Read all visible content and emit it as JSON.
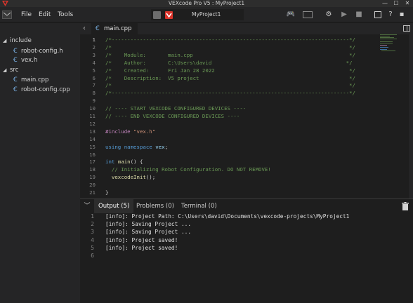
{
  "window": {
    "title": "VEXcode Pro V5 : MyProject1",
    "minimize": "—",
    "maximize": "☐",
    "close": "✕",
    "logo_color": "#d9342b"
  },
  "menu": {
    "items": [
      "File",
      "Edit",
      "Tools"
    ],
    "project_name": "MyProject1"
  },
  "sidebar": {
    "tree": [
      {
        "label": "include",
        "type": "folder",
        "expanded": true,
        "depth": 0
      },
      {
        "label": "robot-config.h",
        "type": "file",
        "depth": 1
      },
      {
        "label": "vex.h",
        "type": "file",
        "depth": 1
      },
      {
        "label": "src",
        "type": "folder",
        "expanded": true,
        "depth": 0
      },
      {
        "label": "main.cpp",
        "type": "file",
        "depth": 1
      },
      {
        "label": "robot-config.cpp",
        "type": "file",
        "depth": 1
      }
    ]
  },
  "editor": {
    "back_label": "‹",
    "active_tab": "main.cpp",
    "active_line": 1,
    "lines": [
      {
        "n": "1",
        "seg": [
          [
            "c-comment",
            "/*----------------------------------------------------------------------------*/"
          ]
        ]
      },
      {
        "n": "2",
        "seg": [
          [
            "c-comment",
            "/*                                                                            */"
          ]
        ]
      },
      {
        "n": "3",
        "seg": [
          [
            "c-comment",
            "/*    Module:       main.cpp                                                  */"
          ]
        ]
      },
      {
        "n": "4",
        "seg": [
          [
            "c-comment",
            "/*    Author:       C:\\Users\\david                                           */"
          ]
        ]
      },
      {
        "n": "5",
        "seg": [
          [
            "c-comment",
            "/*    Created:      Fri Jan 28 2022                                           */"
          ]
        ]
      },
      {
        "n": "6",
        "seg": [
          [
            "c-comment",
            "/*    Description:  V5 project                                                */"
          ]
        ]
      },
      {
        "n": "7",
        "seg": [
          [
            "c-comment",
            "/*                                                                            */"
          ]
        ]
      },
      {
        "n": "8",
        "seg": [
          [
            "c-comment",
            "/*----------------------------------------------------------------------------*/"
          ]
        ]
      },
      {
        "n": "9",
        "seg": []
      },
      {
        "n": "10",
        "seg": [
          [
            "c-comment",
            "// ---- START VEXCODE CONFIGURED DEVICES ----"
          ]
        ]
      },
      {
        "n": "11",
        "seg": [
          [
            "c-comment",
            "// ---- END VEXCODE CONFIGURED DEVICES ----"
          ]
        ]
      },
      {
        "n": "12",
        "seg": []
      },
      {
        "n": "13",
        "seg": [
          [
            "c-pre",
            "#include "
          ],
          [
            "c-str",
            "\"vex.h\""
          ]
        ]
      },
      {
        "n": "14",
        "seg": []
      },
      {
        "n": "15",
        "seg": [
          [
            "c-kw",
            "using namespace "
          ],
          [
            "c-var",
            "vex"
          ],
          [
            "c-plain",
            ";"
          ]
        ]
      },
      {
        "n": "16",
        "seg": []
      },
      {
        "n": "17",
        "seg": [
          [
            "c-kw",
            "int "
          ],
          [
            "c-fn",
            "main"
          ],
          [
            "c-plain",
            "() {"
          ]
        ]
      },
      {
        "n": "18",
        "seg": [
          [
            "c-comment",
            "  // Initializing Robot Configuration. DO NOT REMOVE!"
          ]
        ]
      },
      {
        "n": "19",
        "seg": [
          [
            "c-fn",
            "  vexcodeInit"
          ],
          [
            "c-plain",
            "();"
          ]
        ]
      },
      {
        "n": "20",
        "seg": []
      },
      {
        "n": "21",
        "seg": [
          [
            "c-plain",
            "}"
          ]
        ]
      }
    ]
  },
  "panel": {
    "tabs": [
      {
        "label": "Output (5)",
        "active": true
      },
      {
        "label": "Problems (0)",
        "active": false
      },
      {
        "label": "Terminal (0)",
        "active": false
      }
    ],
    "output": [
      {
        "n": "1",
        "text": "[info]: Project Path: C:\\Users\\david\\Documents\\vexcode-projects\\MyProject1"
      },
      {
        "n": "2",
        "text": "[info]: Saving Project ..."
      },
      {
        "n": "3",
        "text": "[info]: Saving Project ..."
      },
      {
        "n": "4",
        "text": "[info]: Project saved!"
      },
      {
        "n": "5",
        "text": "[info]: Project saved!"
      },
      {
        "n": "6",
        "text": ""
      }
    ]
  },
  "colors": {
    "accent_red": "#d9342b",
    "file_icon": "#7bb3e8"
  }
}
